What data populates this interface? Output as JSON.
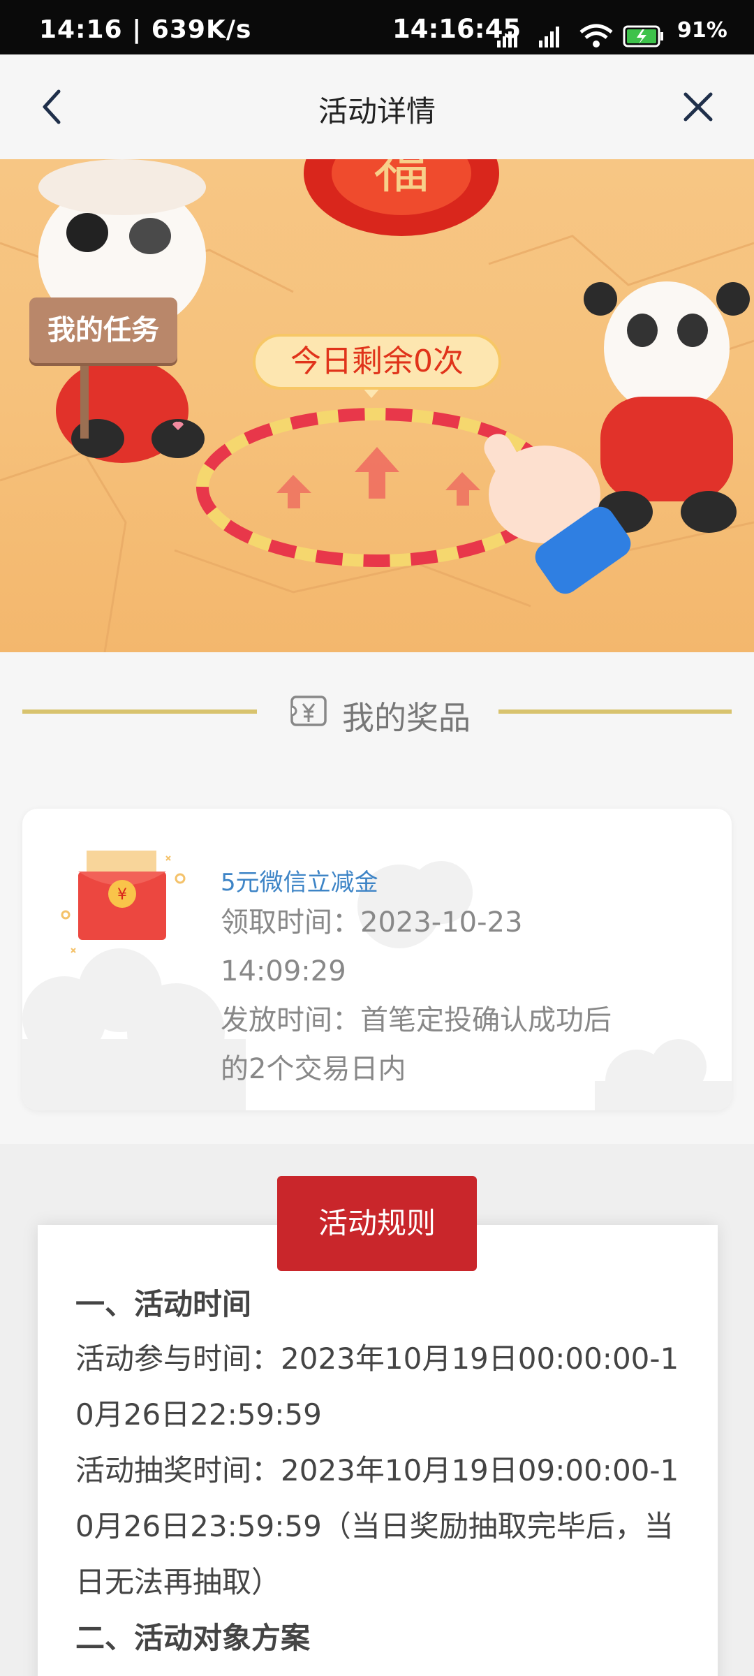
{
  "status_bar": {
    "left": "14:16 | 639K/s",
    "time": "14:16:45",
    "battery": "91%"
  },
  "header": {
    "title": "活动详情"
  },
  "banner": {
    "task_sign": "我的任务",
    "counter": "今日剩余0次",
    "colors": {
      "background": "#f6c17b",
      "accent_red": "#e0331a"
    }
  },
  "prizes": {
    "section_title": "我的奖品",
    "item": {
      "name": "5元微信立减金",
      "claim_line1": "领取时间：2023-10-23",
      "claim_line2": "14:09:29",
      "issue_line1": "发放时间：首笔定投确认成功后",
      "issue_line2": "的2个交易日内"
    }
  },
  "rules": {
    "button_label": "活动规则",
    "heading1": "一、活动时间",
    "lines": [
      "活动参与时间：2023年10月19日00:00:00-1",
      "0月26日22:59:59",
      "活动抽奖时间：2023年10月19日09:00:00-1",
      "0月26日23:59:59（当日奖励抽取完毕后，当",
      "日无法再抽取）"
    ],
    "heading2": "二、活动对象方案"
  }
}
